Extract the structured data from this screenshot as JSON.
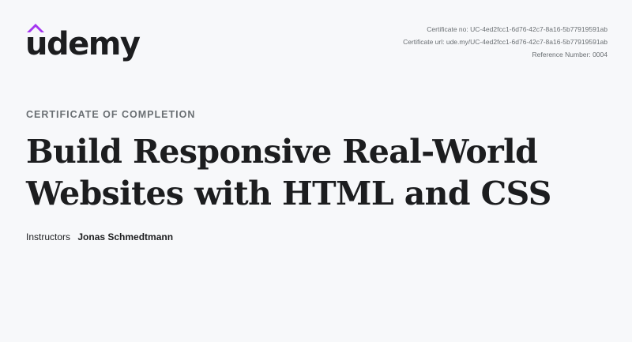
{
  "brand": {
    "name": "udemy",
    "accent_color": "#a435f0"
  },
  "certificate": {
    "number": "Certificate no: UC-4ed2fcc1-6d76-42c7-8a16-5b77919591ab",
    "url": "Certificate url: ude.my/UC-4ed2fcc1-6d76-42c7-8a16-5b77919591ab",
    "reference": "Reference Number: 0004"
  },
  "heading": {
    "eyebrow": "CERTIFICATE OF COMPLETION",
    "title": "Build Responsive Real-World Websites with HTML and CSS"
  },
  "instructors": {
    "label": "Instructors",
    "names": "Jonas Schmedtmann"
  }
}
